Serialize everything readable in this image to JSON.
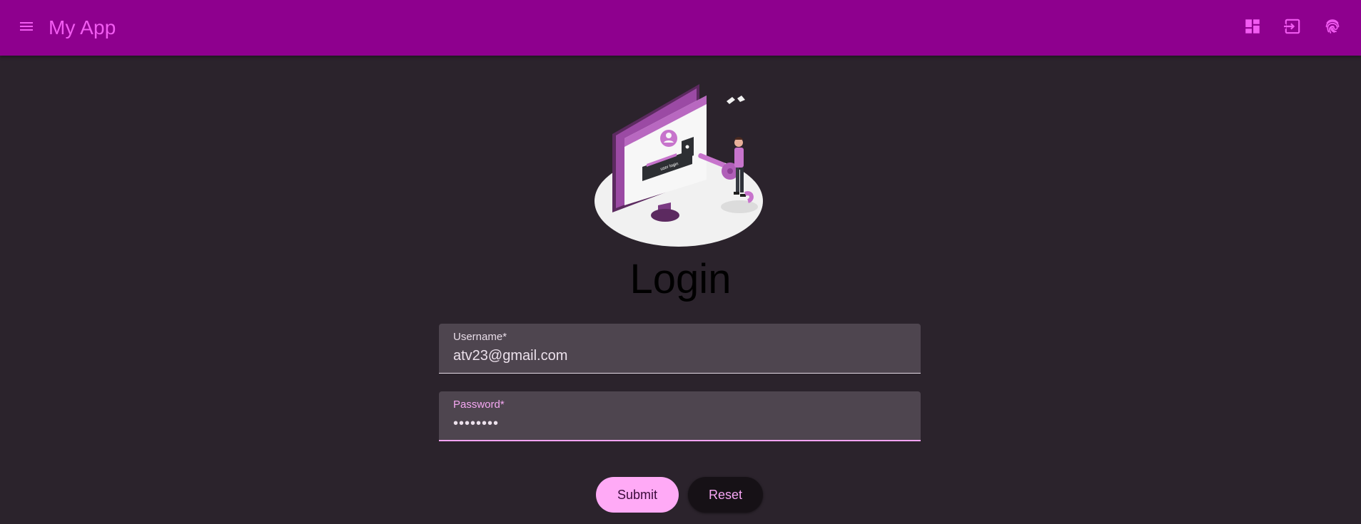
{
  "app": {
    "title": "My App"
  },
  "toolbar": {
    "menu_icon": "menu-icon",
    "actions": [
      "dashboard-icon",
      "login-icon",
      "fingerprint-icon"
    ],
    "accent_color": "#8e008e",
    "title_color": "#f25cf2"
  },
  "login": {
    "title": "Login",
    "illustration_text": "user login",
    "username": {
      "label": "Username*",
      "value": "atv23@gmail.com"
    },
    "password": {
      "label": "Password*",
      "value": "••••••••"
    },
    "submit_label": "Submit",
    "reset_label": "Reset"
  }
}
